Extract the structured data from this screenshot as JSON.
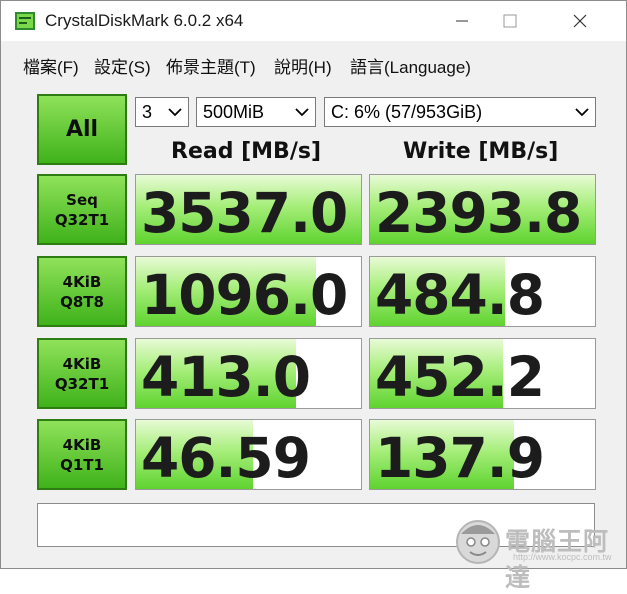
{
  "window": {
    "title": "CrystalDiskMark 6.0.2 x64"
  },
  "menu": [
    {
      "label": "檔案(F)"
    },
    {
      "label": "設定(S)"
    },
    {
      "label": "佈景主題(T)"
    },
    {
      "label": "說明(H)"
    },
    {
      "label": "語言(Language)"
    }
  ],
  "controls": {
    "all_label": "All",
    "count": "3",
    "size": "500MiB",
    "drive": "C: 6% (57/953GiB)"
  },
  "headers": {
    "read": "Read [MB/s]",
    "write": "Write [MB/s]"
  },
  "rows": [
    {
      "line1": "Seq",
      "line2": "Q32T1",
      "read": "3537.0",
      "write": "2393.8",
      "read_fill_pct": 100,
      "write_fill_pct": 100
    },
    {
      "line1": "4KiB",
      "line2": "Q8T8",
      "read": "1096.0",
      "write": "484.8",
      "read_fill_pct": 80,
      "write_fill_pct": 60
    },
    {
      "line1": "4KiB",
      "line2": "Q32T1",
      "read": "413.0",
      "write": "452.2",
      "read_fill_pct": 71,
      "write_fill_pct": 59
    },
    {
      "line1": "4KiB",
      "line2": "Q1T1",
      "read": "46.59",
      "write": "137.9",
      "read_fill_pct": 52,
      "write_fill_pct": 64
    }
  ],
  "comment": "",
  "watermark": {
    "text": "電腦王阿達",
    "url": "http://www.kocpc.com.tw"
  },
  "colors": {
    "accent_green": "#3fb21a",
    "fill_green": "#5fd32f"
  }
}
